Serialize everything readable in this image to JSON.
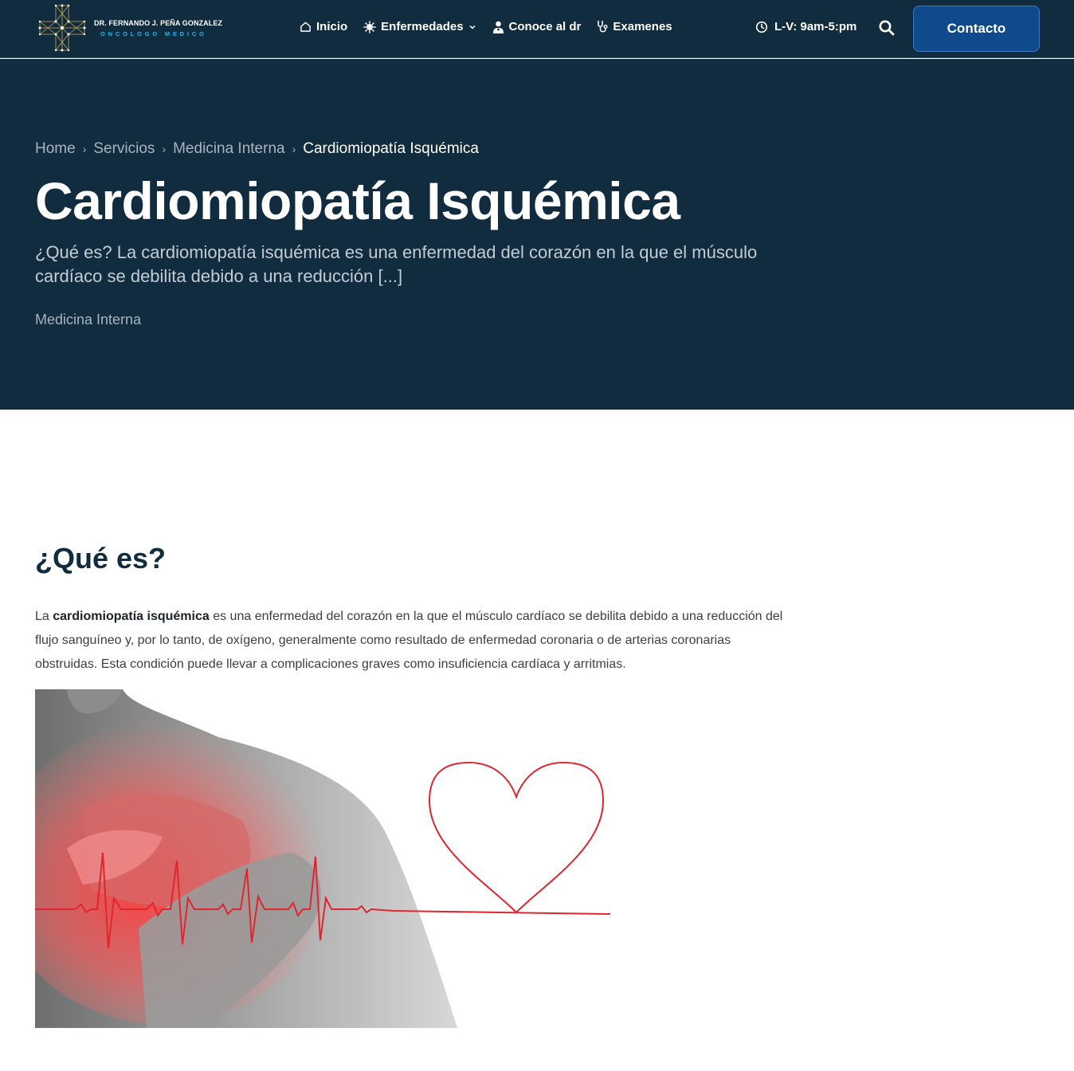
{
  "header": {
    "logo": {
      "name": "DR. FERNANDO J. PEÑA GONZALEZ",
      "subtitle": "ONCOLOGO MEDICO"
    },
    "nav": [
      {
        "label": "Inicio",
        "icon": "home-icon"
      },
      {
        "label": "Enfermedades",
        "icon": "virus-icon",
        "has_dropdown": true
      },
      {
        "label": "Conoce al dr",
        "icon": "doctor-icon"
      },
      {
        "label": "Examenes",
        "icon": "stethoscope-icon"
      }
    ],
    "hours": "L-V: 9am-5:pm",
    "contact_label": "Contacto"
  },
  "hero": {
    "breadcrumb": [
      "Home",
      "Servicios",
      "Medicina Interna",
      "Cardiomiopatía Isquémica"
    ],
    "title": "Cardiomiopatía Isquémica",
    "excerpt": "¿Qué es? La cardiomiopatía isquémica es una enfermedad del corazón en la que el músculo cardíaco se debilita debido a una reducción [...]",
    "category": "Medicina Interna"
  },
  "content": {
    "heading": "¿Qué es?",
    "paragraph": {
      "lead": "La ",
      "strong": "cardiomiopatía isquémica",
      "rest": " es una enfermedad del corazón en la que el músculo cardíaco se debilita debido a una reducción del flujo sanguíneo y, por lo tanto, de oxígeno, generalmente como resultado de enfermedad coronaria o de arterias coronarias obstruidas. Esta condición puede llevar a complicaciones graves como insuficiencia cardíaca y arritmias."
    }
  },
  "colors": {
    "navy": "#122c3f",
    "button_blue": "#0f4a8c",
    "accent_cyan": "#1fb4e6",
    "logo_gold": "#c9a94a",
    "heart_red": "#e0252f"
  }
}
